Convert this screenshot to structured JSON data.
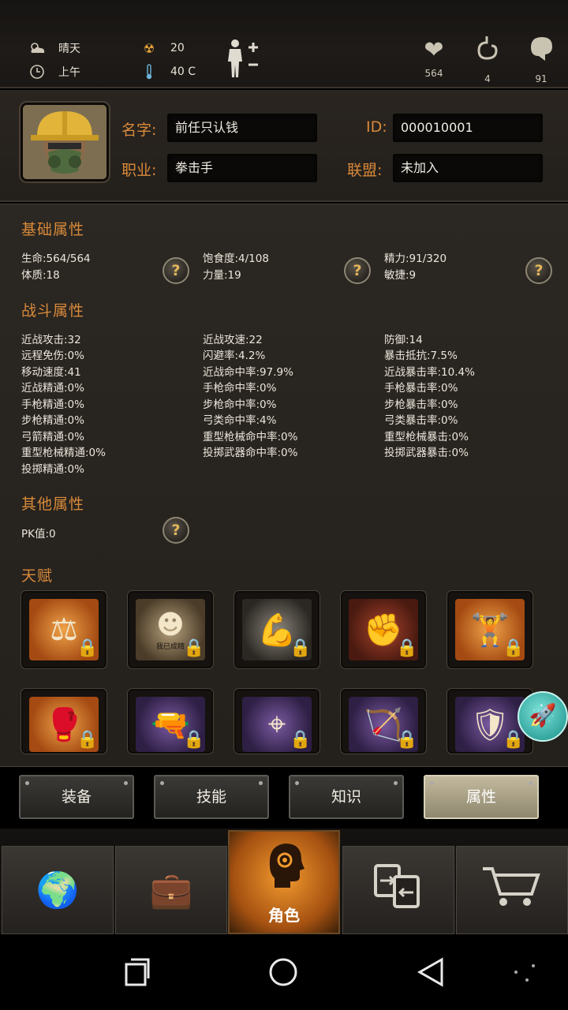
{
  "status": {
    "weather": "晴天",
    "time_of_day": "上午",
    "radiation": "20",
    "temperature": "40 C",
    "health": "564",
    "hunger": "4",
    "mood": "91"
  },
  "profile": {
    "name_label": "名字",
    "name": "前任只认钱",
    "id_label": "ID",
    "id": "000010001",
    "job_label": "职业",
    "job": "拳击手",
    "alliance_label": "联盟",
    "alliance": "未加入"
  },
  "basic": {
    "title": "基础属性",
    "stats": [
      "生命:564/564",
      "饱食度:4/108",
      "精力:91/320",
      "体质:18",
      "力量:19",
      "敏捷:9"
    ]
  },
  "combat": {
    "title": "战斗属性",
    "col1": [
      "近战攻击:32",
      "远程免伤:0%",
      "移动速度:41",
      "近战精通:0%",
      "手枪精通:0%",
      "步枪精通:0%",
      "弓箭精通:0%",
      "重型枪械精通:0%",
      "投掷精通:0%"
    ],
    "col2": [
      "近战攻速:22",
      "闪避率:4.2%",
      "近战命中率:97.9%",
      "手枪命中率:0%",
      "步枪命中率:0%",
      "弓类命中率:4%",
      "重型枪械命中率:0%",
      "投掷武器命中率:0%"
    ],
    "col3": [
      "防御:14",
      "暴击抵抗:7.5%",
      "近战暴击率:10.4%",
      "手枪暴击率:0%",
      "步枪暴击率:0%",
      "弓类暴击率:0%",
      "重型枪械暴击:0%",
      "投掷武器暴击:0%"
    ]
  },
  "other": {
    "title": "其他属性",
    "pk": "PK值:0"
  },
  "talent": {
    "title": "天赋",
    "badge_text": "我已成精"
  },
  "subtabs": [
    "装备",
    "技能",
    "知识",
    "属性"
  ],
  "nav": {
    "active_label": "角色"
  },
  "icons": [
    "cloud-sun-icon",
    "clock-icon",
    "radiation-icon",
    "thermometer-icon",
    "body-add-icon",
    "heart-icon",
    "stomach-icon",
    "brain-icon",
    "question-icon",
    "lock-icon",
    "rocket-icon",
    "globe-icon",
    "briefcase-icon",
    "head-gears-icon",
    "exchange-icon",
    "cart-icon"
  ],
  "colors": {
    "accent": "#d98a3a",
    "active_tab": "#c2b99e",
    "nav_active": "#f29a2e"
  }
}
